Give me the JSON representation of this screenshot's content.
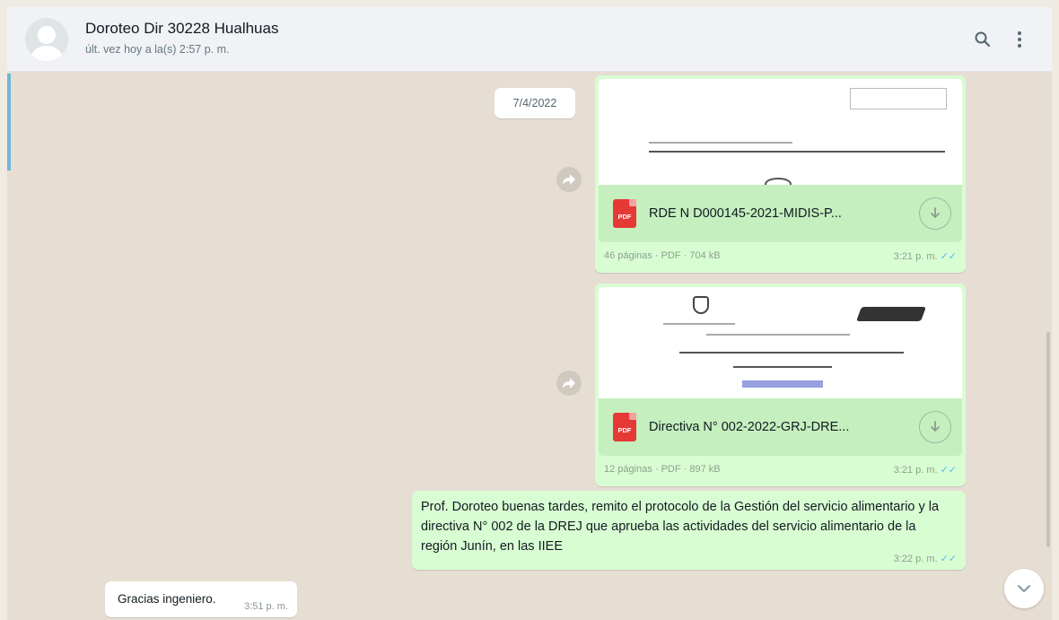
{
  "header": {
    "contact_name": "Doroteo Dir 30228 Hualhuas",
    "last_seen": "últ. vez hoy a la(s) 2:57 p. m.",
    "icons": [
      "search-icon",
      "menu-icon"
    ]
  },
  "chat": {
    "date_chip": "7/4/2022",
    "messages": [
      {
        "type": "document",
        "file_icon": "PDF",
        "file_name": "RDE N D000145-2021-MIDIS-P...",
        "meta": "46 páginas · PDF · 704 kB",
        "time": "3:21 p. m."
      },
      {
        "type": "document",
        "file_icon": "PDF",
        "file_name": "Directiva N° 002-2022-GRJ-DRE...",
        "meta": "12 páginas · PDF · 897 kB",
        "time": "3:21 p. m."
      },
      {
        "type": "text",
        "text": "Prof. Doroteo buenas tardes, remito el protocolo de la Gestión del servicio alimentario y la directiva N° 002 de la DREJ que aprueba las actividades del servicio alimentario de la región Junín, en las IIEE",
        "time": "3:22 p. m."
      },
      {
        "type": "incoming",
        "text": "Gracias ingeniero.",
        "time": "3:51 p. m."
      }
    ]
  },
  "colors": {
    "outgoing_bubble": "#d9fdd3",
    "incoming_bubble": "#ffffff",
    "chat_background": "#e6ded3",
    "header_background": "#f0f2f5",
    "read_tick": "#53bdeb",
    "pdf_red": "#e53935"
  }
}
